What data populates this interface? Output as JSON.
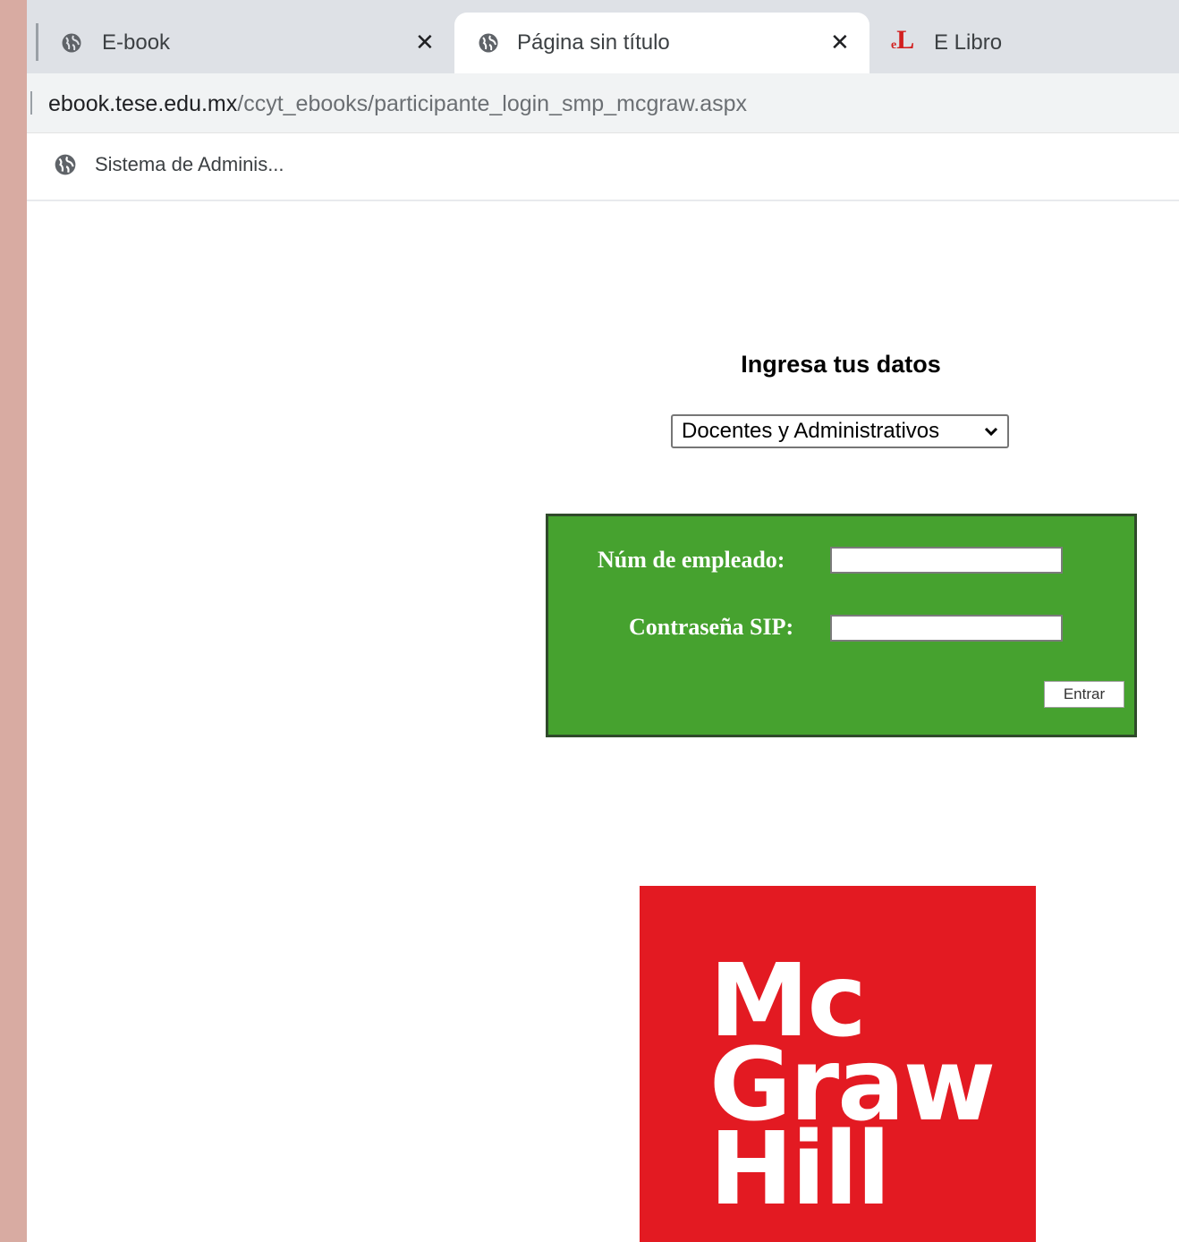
{
  "tabs": [
    {
      "title": "E-book",
      "icon": "globe-icon"
    },
    {
      "title": "Página sin título",
      "icon": "globe-icon",
      "active": true
    },
    {
      "title": "E Libro",
      "icon": "elibro-logo-icon"
    }
  ],
  "address": {
    "host": "ebook.tese.edu.mx",
    "path": "/ccyt_ebooks/participante_login_smp_mcgraw.aspx"
  },
  "bookmarks": [
    {
      "label": "Sistema de Adminis...",
      "icon": "globe-icon"
    }
  ],
  "page": {
    "heading": "Ingresa tus datos",
    "role_select": {
      "selected": "Docentes y Administrativos"
    },
    "login": {
      "employee_label": "Núm de empleado:",
      "employee_value": "",
      "password_label": "Contraseña SIP:",
      "password_value": "",
      "submit_label": "Entrar",
      "background_color": "#46a22f"
    },
    "logo": {
      "lines": [
        "Mc",
        "Graw",
        "Hill"
      ],
      "background_color": "#e31a22"
    }
  }
}
